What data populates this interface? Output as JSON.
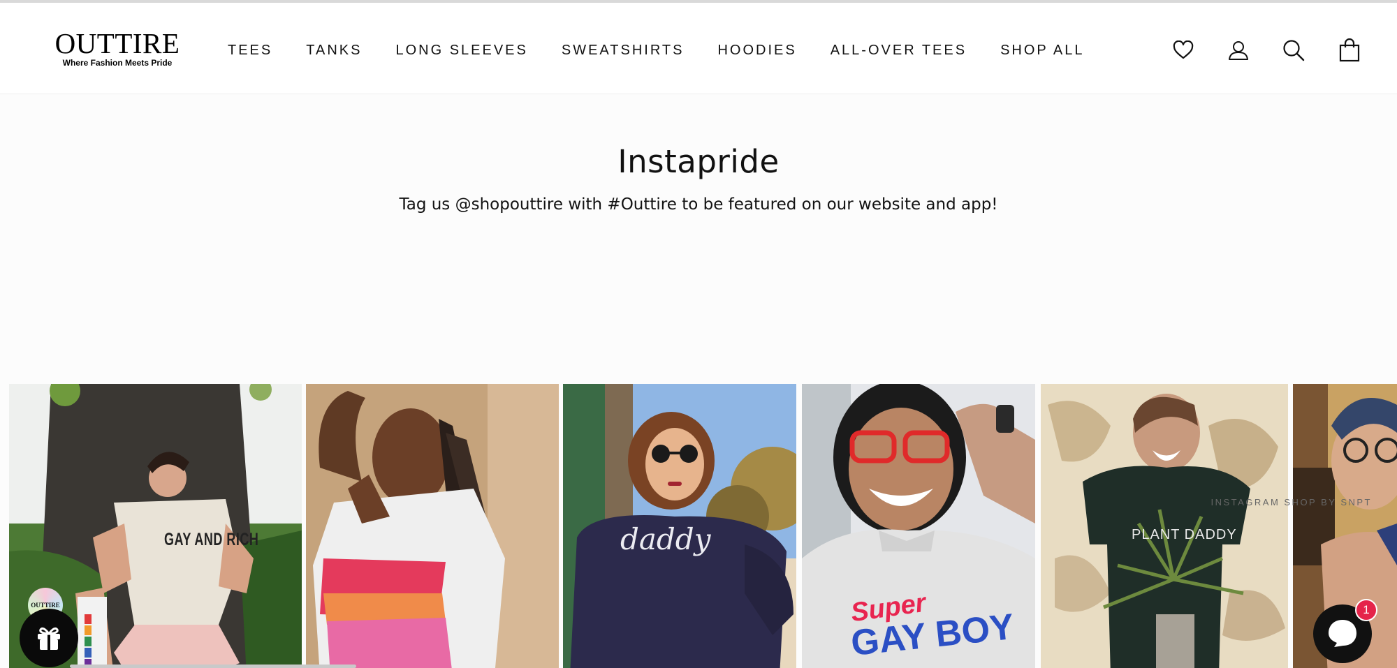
{
  "brand": {
    "logo_word": "OUTTIRE",
    "tagline": "Where Fashion Meets Pride"
  },
  "nav": {
    "items": [
      {
        "label": "TEES"
      },
      {
        "label": "TANKS"
      },
      {
        "label": "LONG SLEEVES"
      },
      {
        "label": "SWEATSHIRTS"
      },
      {
        "label": "HOODIES"
      },
      {
        "label": "ALL-OVER TEES"
      },
      {
        "label": "SHOP ALL"
      }
    ]
  },
  "header_icons": [
    "heart-icon",
    "account-icon",
    "search-icon",
    "cart-icon"
  ],
  "instapride": {
    "title": "Instapride",
    "subtitle": "Tag us @shopouttire with #Outtire to be featured on our website and app!",
    "credit": "INSTAGRAM SHOP BY SNPT",
    "photos": [
      {
        "shirt_text": "GAY AND RICH"
      },
      {
        "shirt_text": ""
      },
      {
        "shirt_text": "daddy"
      },
      {
        "shirt_text_1": "Super",
        "shirt_text_2": "GAY BOY"
      },
      {
        "shirt_text": "PLANT DADDY"
      },
      {
        "shirt_text": ""
      }
    ]
  },
  "widgets": {
    "badge_text": "OUTTIRE",
    "chat_unread": "1",
    "gift_icon": "gift-icon",
    "chat_icon": "chat-icon"
  },
  "colors": {
    "text": "#111111",
    "chat_badge": "#e5244a",
    "widget_bg": "#0a0a0a"
  }
}
